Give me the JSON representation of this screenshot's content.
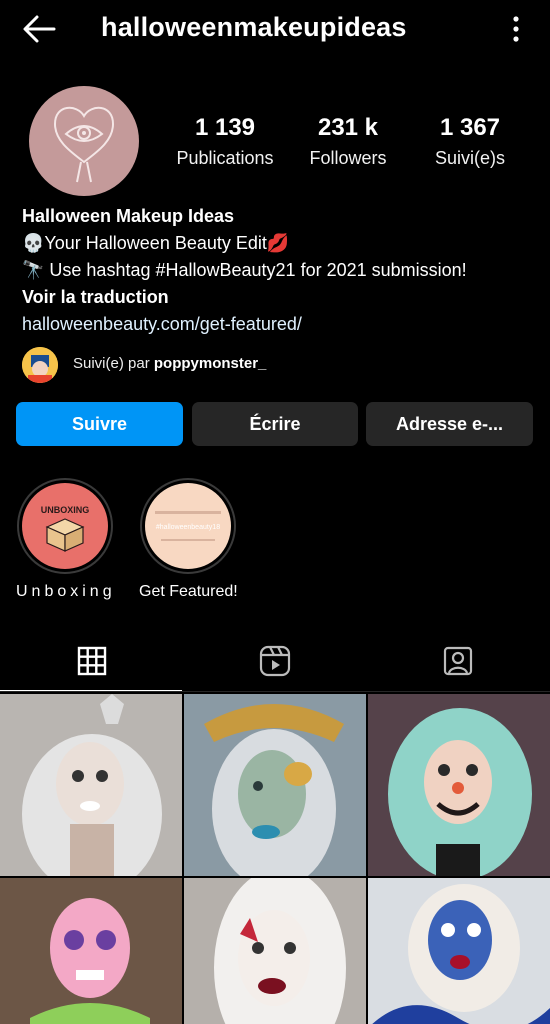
{
  "header": {
    "username": "halloweenmakeupideas"
  },
  "stats": [
    {
      "value": "1 139",
      "label": "Publications"
    },
    {
      "value": "231 k",
      "label": "Followers"
    },
    {
      "value": "1 367",
      "label": "Suivi(e)s"
    }
  ],
  "bio": {
    "name": "Halloween Makeup Ideas",
    "line1": "💀Your Halloween Beauty Edit💋",
    "line2": "🔭 Use hashtag #HallowBeauty21 for 2021 submission!",
    "translate": "Voir la traduction",
    "link": "halloweenbeauty.com/get-featured/"
  },
  "followed_by": {
    "prefix": "Suivi(e) par",
    "user": "poppymonster_"
  },
  "buttons": {
    "follow": "Suivre",
    "write": "Écrire",
    "email": "Adresse e-..."
  },
  "highlights": [
    {
      "label": "Unboxing",
      "cover_text": "UNBOXING"
    },
    {
      "label": "Get Featured!",
      "cover_text": "#halloweenbeauty18"
    }
  ],
  "tabs": [
    {
      "name": "grid-icon",
      "active": true
    },
    {
      "name": "reels-icon",
      "active": false
    },
    {
      "name": "tagged-icon",
      "active": false
    }
  ],
  "colors": {
    "accent": "#0095f6",
    "button_dark": "#262626",
    "avatar_pink": "#c49a9a"
  }
}
